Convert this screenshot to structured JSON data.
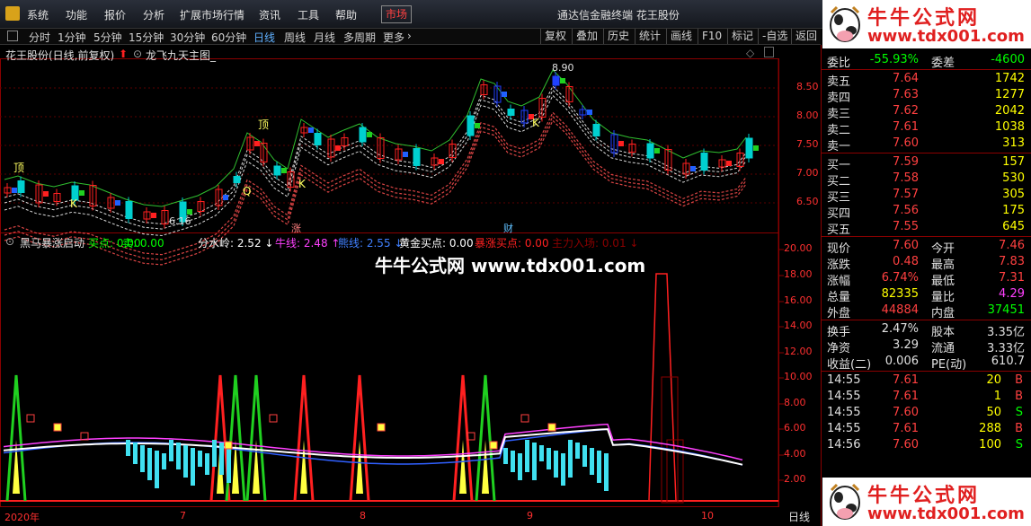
{
  "menu": {
    "items": [
      "系统",
      "功能",
      "报价",
      "分析",
      "扩展市场行情",
      "资讯",
      "工具",
      "帮助"
    ],
    "active": "市场",
    "title": "通达信金融终端  花王股份"
  },
  "toolbar": {
    "periods": [
      "分时",
      "1分钟",
      "5分钟",
      "15分钟",
      "30分钟",
      "60分钟",
      "日线",
      "周线",
      "月线",
      "多周期",
      "更多"
    ],
    "selected": "日线",
    "right_buttons": [
      "复权",
      "叠加",
      "历史",
      "统计",
      "画线",
      "F10",
      "标记",
      "-自选",
      "返回"
    ]
  },
  "main_chart": {
    "title": "花王股份(日线,前复权)",
    "indicator": "龙飞九天主图_",
    "high_label": "8.90",
    "low_label": "6.16",
    "y_ticks": [
      "8.50",
      "8.00",
      "7.50",
      "7.00",
      "6.50"
    ],
    "markers": {
      "ding": "顶",
      "k": "K",
      "q": "Q",
      "zhang": "涨",
      "cai": "财"
    }
  },
  "sub_chart": {
    "title": "黑马暴涨启动",
    "items": [
      {
        "label": "买点:",
        "value": "0.00",
        "color": "#00ff00"
      },
      {
        "label": "卖:",
        "value": "0.00",
        "color": "#00ff00"
      },
      {
        "label": "分水岭:",
        "value": "2.52",
        "color": "#ffffff",
        "arrow": "↓"
      },
      {
        "label": "牛线:",
        "value": "2.48",
        "color": "#ff40ff",
        "arrow": "↑"
      },
      {
        "label": "熊线:",
        "value": "2.55",
        "color": "#4080ff",
        "arrow": "↓"
      },
      {
        "label": "黄金买点:",
        "value": "0.00",
        "color": "#ffffff"
      },
      {
        "label": "暴涨买点:",
        "value": "0.00",
        "color": "#ff2020"
      },
      {
        "label": "主力入场:",
        "value": "0.01",
        "color": "#8b0000",
        "arrow": "↓"
      }
    ],
    "y_ticks": [
      "20.00",
      "18.00",
      "16.00",
      "14.00",
      "12.00",
      "10.00",
      "8.00",
      "6.00",
      "4.00",
      "2.00"
    ]
  },
  "x_axis": {
    "labels": [
      "2020年",
      "7",
      "8",
      "9",
      "10"
    ],
    "period_label": "日线"
  },
  "watermark": "牛牛公式网 www.tdx001.com",
  "ad": {
    "title": "牛牛公式网",
    "url": "www.tdx001.com"
  },
  "quote": {
    "weibi": {
      "label": "委比",
      "value": "-55.93%",
      "diff_label": "委差",
      "diff": "-4600"
    },
    "asks": [
      {
        "label": "卖五",
        "price": "7.64",
        "vol": "1742"
      },
      {
        "label": "卖四",
        "price": "7.63",
        "vol": "1277"
      },
      {
        "label": "卖三",
        "price": "7.62",
        "vol": "2042"
      },
      {
        "label": "卖二",
        "price": "7.61",
        "vol": "1038"
      },
      {
        "label": "卖一",
        "price": "7.60",
        "vol": "313"
      }
    ],
    "bids": [
      {
        "label": "买一",
        "price": "7.59",
        "vol": "157"
      },
      {
        "label": "买二",
        "price": "7.58",
        "vol": "530"
      },
      {
        "label": "买三",
        "price": "7.57",
        "vol": "305"
      },
      {
        "label": "买四",
        "price": "7.56",
        "vol": "175"
      },
      {
        "label": "买五",
        "price": "7.55",
        "vol": "645"
      }
    ],
    "stats": [
      {
        "l1": "现价",
        "v1": "7.60",
        "c1": "#ff4040",
        "l2": "今开",
        "v2": "7.46",
        "c2": "#ff4040"
      },
      {
        "l1": "涨跌",
        "v1": "0.48",
        "c1": "#ff4040",
        "l2": "最高",
        "v2": "7.83",
        "c2": "#ff4040"
      },
      {
        "l1": "涨幅",
        "v1": "6.74%",
        "c1": "#ff4040",
        "l2": "最低",
        "v2": "7.31",
        "c2": "#ff4040"
      },
      {
        "l1": "总量",
        "v1": "82335",
        "c1": "#ffff00",
        "l2": "量比",
        "v2": "4.29",
        "c2": "#ff40ff"
      },
      {
        "l1": "外盘",
        "v1": "44884",
        "c1": "#ff4040",
        "l2": "内盘",
        "v2": "37451",
        "c2": "#00ff00"
      }
    ],
    "stats2": [
      {
        "l1": "换手",
        "v1": "2.47%",
        "l2": "股本",
        "v2": "3.35亿"
      },
      {
        "l1": "净资",
        "v1": "3.29",
        "l2": "流通",
        "v2": "3.33亿"
      },
      {
        "l1": "收益(二)",
        "v1": "0.006",
        "l2": "PE(动)",
        "v2": "610.7"
      }
    ],
    "ticks": [
      {
        "time": "14:55",
        "price": "7.61",
        "vol": "20",
        "side": "B"
      },
      {
        "time": "14:55",
        "price": "7.61",
        "vol": "1",
        "side": "B"
      },
      {
        "time": "14:55",
        "price": "7.60",
        "vol": "50",
        "side": "S"
      },
      {
        "time": "14:55",
        "price": "7.61",
        "vol": "288",
        "side": "B"
      },
      {
        "time": "14:56",
        "price": "7.60",
        "vol": "100",
        "side": "S"
      }
    ]
  }
}
